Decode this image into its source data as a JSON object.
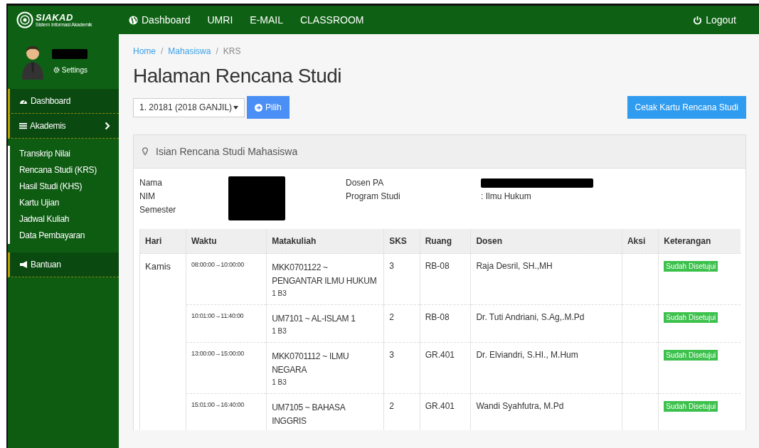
{
  "brand": {
    "name": "SIAKAD",
    "tagline": "Sistem Informasi Akademik"
  },
  "topnav": {
    "items": [
      {
        "label": "Dashboard"
      },
      {
        "label": "UMRI"
      },
      {
        "label": "E-MAIL"
      },
      {
        "label": "CLASSROOM"
      }
    ],
    "logout": "Logout"
  },
  "user": {
    "settings": "Settings"
  },
  "sidebar": {
    "items": [
      {
        "kind": "item",
        "label": "Dashboard"
      },
      {
        "kind": "group",
        "label": "Akademis",
        "expanded": true,
        "children": [
          {
            "label": "Transkrip Nilai"
          },
          {
            "label": "Rencana Studi (KRS)"
          },
          {
            "label": "Hasil Studi (KHS)"
          },
          {
            "label": "Kartu Ujian"
          },
          {
            "label": "Jadwal Kuliah"
          },
          {
            "label": "Data Pembayaran"
          }
        ]
      },
      {
        "kind": "item",
        "label": "Bantuan"
      }
    ]
  },
  "breadcrumb": {
    "separator": "/",
    "items": [
      {
        "label": "Home"
      },
      {
        "label": "Mahasiswa"
      },
      {
        "label": "KRS"
      }
    ]
  },
  "page_title": "Halaman Rencana Studi",
  "semester_select": {
    "value": "1. 20181 (2018 GANJIL)"
  },
  "pick_button": "Pilih",
  "print_button": "Cetak Kartu Rencana Studi",
  "panel": {
    "title": "Isian Rencana Studi Mahasiswa",
    "info_left": [
      {
        "label": "Nama"
      },
      {
        "label": "NIM"
      },
      {
        "label": "Semester"
      }
    ],
    "info_right": [
      {
        "label": "Dosen PA"
      },
      {
        "label": "Program Studi",
        "value": ": Ilmu Hukum"
      }
    ],
    "table": {
      "columns": [
        "Hari",
        "Waktu",
        "Matakuliah",
        "SKS",
        "Ruang",
        "Dosen",
        "Aksi",
        "Keterangan"
      ],
      "day": "Kamis",
      "rows": [
        {
          "waktu": "08:00:00→10:00:00",
          "matakuliah": "MKK0701122 ~ PENGANTAR ILMU HUKUM",
          "kelas": "1 B3",
          "sks": "3",
          "ruang": "RB-08",
          "dosen": "Raja Desril, SH.,MH",
          "status": "Sudah Disetujui"
        },
        {
          "waktu": "10:01:00→11:40:00",
          "matakuliah": "UM7101 ~ AL-ISLAM 1",
          "kelas": "1 B3",
          "sks": "2",
          "ruang": "RB-08",
          "dosen": "Dr. Tuti Andriani, S.Ag,.M.Pd",
          "status": "Sudah Disetujui"
        },
        {
          "waktu": "13:00:00→15:00:00",
          "matakuliah": "MKK0701112 ~ ILMU NEGARA",
          "kelas": "1 B3",
          "sks": "3",
          "ruang": "GR.401",
          "dosen": "Dr. Elviandri, S.HI., M.Hum",
          "status": "Sudah Disetujui"
        },
        {
          "waktu": "15:01:00→16:40:00",
          "matakuliah": "UM7105 ~ BAHASA INGGRIS",
          "sks": "2",
          "ruang": "GR.401",
          "dosen": "Wandi Syahfutra, M.Pd",
          "status": "Sudah Disetujui"
        }
      ]
    }
  }
}
